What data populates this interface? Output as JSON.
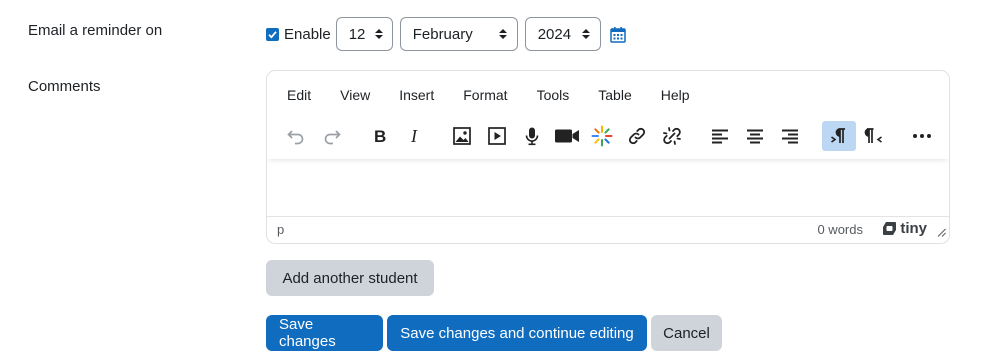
{
  "reminder": {
    "label": "Email a reminder on",
    "enable_label": "Enable",
    "enabled": true,
    "day": "12",
    "month": "February",
    "year": "2024"
  },
  "comments": {
    "label": "Comments",
    "menu": [
      "Edit",
      "View",
      "Insert",
      "Format",
      "Tools",
      "Table",
      "Help"
    ],
    "toolbar_icons": [
      "undo-icon",
      "redo-icon",
      "bold-icon",
      "italic-icon",
      "image-icon",
      "media-icon",
      "microphone-icon",
      "video-camera-icon",
      "ai-sparkle-icon",
      "link-icon",
      "unlink-icon",
      "align-left-icon",
      "align-center-icon",
      "align-right-icon",
      "ltr-icon",
      "rtl-icon",
      "more-icon"
    ],
    "path": "p",
    "word_count": "0 words",
    "brand": "tiny"
  },
  "buttons": {
    "add_student": "Add another student",
    "save": "Save changes",
    "save_continue": "Save changes and continue editing",
    "cancel": "Cancel"
  },
  "colors": {
    "primary": "#0f6cbf",
    "secondary": "#ced4da",
    "active_tool": "#bcd7f3"
  }
}
